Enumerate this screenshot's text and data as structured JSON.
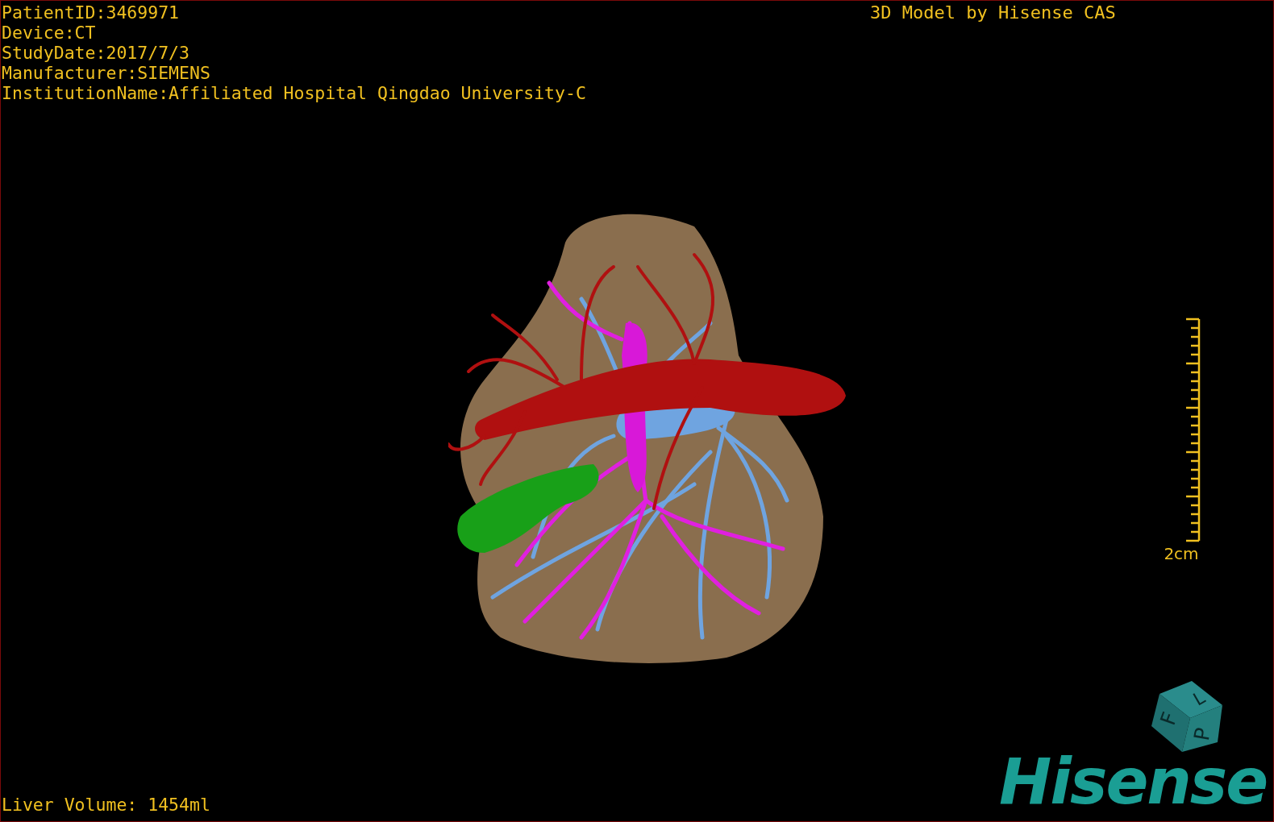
{
  "info_lines": [
    "PatientID:3469971",
    "Device:CT",
    "StudyDate:2017/7/3",
    "Manufacturer:SIEMENS",
    "InstitutionName:Affiliated Hospital Qingdao University-C"
  ],
  "title": "3D Model by Hisense CAS",
  "scale_bar": {
    "label": "2cm"
  },
  "orientation_cube": {
    "labels": [
      "F",
      "L",
      "P"
    ]
  },
  "logo": "Hisense",
  "volume": "Liver Volume: 1454ml"
}
